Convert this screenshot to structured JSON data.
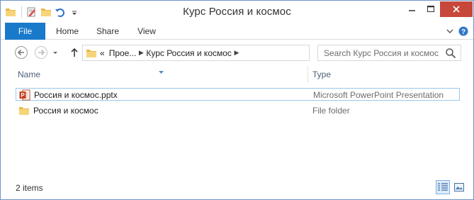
{
  "window": {
    "title": "Курс Россия и космос"
  },
  "quick_access": {
    "icons": [
      "folder-icon",
      "properties-icon",
      "new-folder-icon",
      "undo-icon",
      "customize-dropdown-icon"
    ]
  },
  "ribbon": {
    "tabs": [
      {
        "label": "File",
        "active": true
      },
      {
        "label": "Home",
        "active": false
      },
      {
        "label": "Share",
        "active": false
      },
      {
        "label": "View",
        "active": false
      }
    ]
  },
  "navigation": {
    "breadcrumb_overflow": "«",
    "breadcrumbs": [
      "Прое...",
      "Курс Россия и космос"
    ],
    "search_placeholder": "Search Курс Россия и космос"
  },
  "file_list": {
    "columns": {
      "name": "Name",
      "type": "Type"
    },
    "items": [
      {
        "name": "Россия и космос.pptx",
        "type": "Microsoft PowerPoint Presentation",
        "icon": "powerpoint-file-icon",
        "selected": true
      },
      {
        "name": "Россия и космос",
        "type": "File folder",
        "icon": "folder-icon",
        "selected": false
      }
    ]
  },
  "status_bar": {
    "item_count": "2 items",
    "active_view": "details"
  },
  "colors": {
    "accent": "#1979ca",
    "close_button": "#c7483a",
    "selection_border": "#99c9ef",
    "folder": "#e8b84a"
  }
}
